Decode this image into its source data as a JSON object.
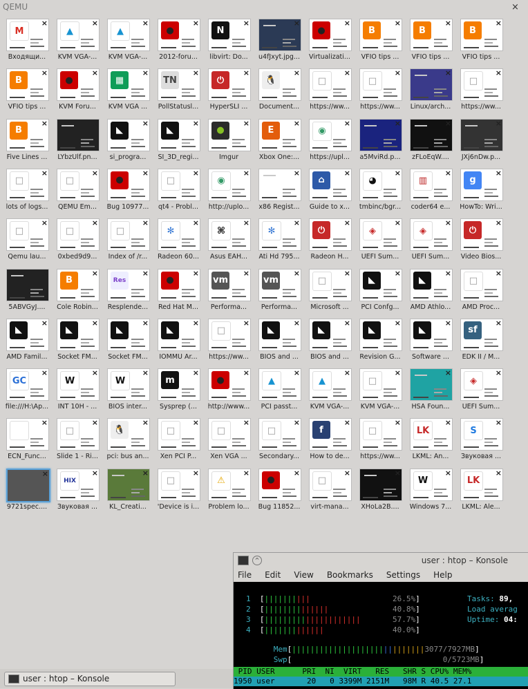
{
  "window": {
    "title": "QEMU",
    "close_glyph": "×"
  },
  "tabs": [
    {
      "label": "Входящи...",
      "icon": "gmail-icon",
      "color": "#ffffff",
      "glyph": "M",
      "gcolor": "#d93025"
    },
    {
      "label": "KVM VGA-...",
      "icon": "arch-linux-icon",
      "color": "#ffffff",
      "glyph": "▲",
      "gcolor": "#1793d1"
    },
    {
      "label": "KVM VGA-...",
      "icon": "arch-linux-icon",
      "color": "#ffffff",
      "glyph": "▲",
      "gcolor": "#1793d1"
    },
    {
      "label": "2012-foru...",
      "icon": "redhat-icon",
      "color": "#cc0000",
      "glyph": "●",
      "gcolor": "#222"
    },
    {
      "label": "libvirt: Do...",
      "icon": "libvirt-icon",
      "color": "#111111",
      "glyph": "N",
      "gcolor": "#fff"
    },
    {
      "label": "u4fJxyt.jpg...",
      "icon": "image-icon",
      "color": "#2b3a55",
      "glyph": "",
      "gcolor": "#fff"
    },
    {
      "label": "Virtualizati...",
      "icon": "redhat-icon",
      "color": "#cc0000",
      "glyph": "●",
      "gcolor": "#222"
    },
    {
      "label": "VFIO tips ...",
      "icon": "blogger-icon",
      "color": "#f57d00",
      "glyph": "B",
      "gcolor": "#fff"
    },
    {
      "label": "VFIO tips ...",
      "icon": "blogger-icon",
      "color": "#f57d00",
      "glyph": "B",
      "gcolor": "#fff"
    },
    {
      "label": "VFIO tips ...",
      "icon": "blogger-icon",
      "color": "#f57d00",
      "glyph": "B",
      "gcolor": "#fff"
    },
    {
      "label": "VFIO tips ...",
      "icon": "blogger-icon",
      "color": "#f57d00",
      "glyph": "B",
      "gcolor": "#fff"
    },
    {
      "label": "KVM Foru...",
      "icon": "redhat-icon",
      "color": "#cc0000",
      "glyph": "●",
      "gcolor": "#222"
    },
    {
      "label": "KVM VGA ...",
      "icon": "sheets-icon",
      "color": "#0f9d58",
      "glyph": "▦",
      "gcolor": "#fff"
    },
    {
      "label": "PollStatusl...",
      "icon": "tn-icon",
      "color": "#dddddd",
      "glyph": "TN",
      "gcolor": "#444"
    },
    {
      "label": "HyperSLI ...",
      "icon": "power-icon",
      "color": "#c62828",
      "glyph": "⏻",
      "gcolor": "#fff"
    },
    {
      "label": "Document...",
      "icon": "linux-icon",
      "color": "#eeeeee",
      "glyph": "🐧",
      "gcolor": "#222"
    },
    {
      "label": "https://ww...",
      "icon": "blank-page-icon",
      "color": "#ffffff",
      "glyph": "□",
      "gcolor": "#999"
    },
    {
      "label": "https://ww...",
      "icon": "blank-page-icon",
      "color": "#ffffff",
      "glyph": "□",
      "gcolor": "#999"
    },
    {
      "label": "Linux/arch...",
      "icon": "image-icon",
      "color": "#3a3a8a",
      "glyph": "",
      "gcolor": "#fff"
    },
    {
      "label": "https://ww...",
      "icon": "blank-page-icon",
      "color": "#ffffff",
      "glyph": "□",
      "gcolor": "#999"
    },
    {
      "label": "Five Lines ...",
      "icon": "blogger-icon",
      "color": "#f57d00",
      "glyph": "B",
      "gcolor": "#fff"
    },
    {
      "label": "LYbzUlf.pn...",
      "icon": "image-icon",
      "color": "#222222",
      "glyph": "",
      "gcolor": "#fff"
    },
    {
      "label": "si_progra...",
      "icon": "amd-icon",
      "color": "#111111",
      "glyph": "◣",
      "gcolor": "#fff"
    },
    {
      "label": "SI_3D_regi...",
      "icon": "amd-icon",
      "color": "#111111",
      "glyph": "◣",
      "gcolor": "#fff"
    },
    {
      "label": "Imgur",
      "icon": "imgur-icon",
      "color": "#2b2b2b",
      "glyph": "●",
      "gcolor": "#85bf25"
    },
    {
      "label": "Xbox One:...",
      "icon": "e-icon",
      "color": "#e35d0c",
      "glyph": "E",
      "gcolor": "#fff"
    },
    {
      "label": "https://upl...",
      "icon": "wikimedia-icon",
      "color": "#ffffff",
      "glyph": "◉",
      "gcolor": "#339966"
    },
    {
      "label": "a5MviRd.p...",
      "icon": "image-icon",
      "color": "#1a237e",
      "glyph": "",
      "gcolor": "#fff"
    },
    {
      "label": "zFLoEqW....",
      "icon": "image-icon",
      "color": "#111111",
      "glyph": "",
      "gcolor": "#fff"
    },
    {
      "label": "JXj6nDw.p...",
      "icon": "image-icon",
      "color": "#333333",
      "glyph": "",
      "gcolor": "#fff"
    },
    {
      "label": "lots of logs...",
      "icon": "blank-page-icon",
      "color": "#ffffff",
      "glyph": "□",
      "gcolor": "#999"
    },
    {
      "label": "QEMU Em...",
      "icon": "blank-page-icon",
      "color": "#ffffff",
      "glyph": "□",
      "gcolor": "#999"
    },
    {
      "label": "Bug 10977...",
      "icon": "redhat-icon",
      "color": "#cc0000",
      "glyph": "●",
      "gcolor": "#222"
    },
    {
      "label": "qt4 - Probl...",
      "icon": "blank-page-icon",
      "color": "#ffffff",
      "glyph": "□",
      "gcolor": "#999"
    },
    {
      "label": "http://uplo...",
      "icon": "wikimedia-icon",
      "color": "#ffffff",
      "glyph": "◉",
      "gcolor": "#339966"
    },
    {
      "label": "x86 Regist...",
      "icon": "image-icon",
      "color": "#ffffff",
      "glyph": "",
      "gcolor": "#fff"
    },
    {
      "label": "Guide to x...",
      "icon": "museum-icon",
      "color": "#2e5aa8",
      "glyph": "⌂",
      "gcolor": "#fff"
    },
    {
      "label": "tmbinc/bgr...",
      "icon": "github-icon",
      "color": "#ffffff",
      "glyph": "◕",
      "gcolor": "#111"
    },
    {
      "label": "coder64 e...",
      "icon": "grid-icon",
      "color": "#ffffff",
      "glyph": "▥",
      "gcolor": "#b22"
    },
    {
      "label": "HowTo: Wri...",
      "icon": "google-icon",
      "color": "#4285f4",
      "glyph": "g",
      "gcolor": "#fff"
    },
    {
      "label": "Qemu lau...",
      "icon": "blank-page-icon",
      "color": "#ffffff",
      "glyph": "□",
      "gcolor": "#999"
    },
    {
      "label": "0xbed9d9...",
      "icon": "blank-page-icon",
      "color": "#ffffff",
      "glyph": "□",
      "gcolor": "#999"
    },
    {
      "label": "Index of /r...",
      "icon": "blank-page-icon",
      "color": "#ffffff",
      "glyph": "□",
      "gcolor": "#999"
    },
    {
      "label": "Radeon 60...",
      "icon": "flower-icon",
      "color": "#ffffff",
      "glyph": "✻",
      "gcolor": "#3a7bd5"
    },
    {
      "label": "Asus EAH...",
      "icon": "command-icon",
      "color": "#ffffff",
      "glyph": "⌘",
      "gcolor": "#111"
    },
    {
      "label": "Ati Hd 795...",
      "icon": "flower-icon",
      "color": "#ffffff",
      "glyph": "✻",
      "gcolor": "#3a7bd5"
    },
    {
      "label": "Radeon H...",
      "icon": "power-icon",
      "color": "#c62828",
      "glyph": "⏻",
      "gcolor": "#fff"
    },
    {
      "label": "UEFI Sum...",
      "icon": "cube-icon",
      "color": "#ffffff",
      "glyph": "◈",
      "gcolor": "#c62828"
    },
    {
      "label": "UEFI Sum...",
      "icon": "cube-icon",
      "color": "#ffffff",
      "glyph": "◈",
      "gcolor": "#c62828"
    },
    {
      "label": "Video Bios...",
      "icon": "power-icon",
      "color": "#c62828",
      "glyph": "⏻",
      "gcolor": "#fff"
    },
    {
      "label": "5ABVGyJ....",
      "icon": "image-icon",
      "color": "#222222",
      "glyph": "",
      "gcolor": "#fff"
    },
    {
      "label": "Cole Robin...",
      "icon": "blogger-icon",
      "color": "#f57d00",
      "glyph": "B",
      "gcolor": "#fff"
    },
    {
      "label": "Resplende...",
      "icon": "res-icon",
      "color": "#eeeeff",
      "glyph": "Res",
      "gcolor": "#7a3fc9"
    },
    {
      "label": "Red Hat M...",
      "icon": "redhat-icon",
      "color": "#cc0000",
      "glyph": "●",
      "gcolor": "#222"
    },
    {
      "label": "Performa...",
      "icon": "vmware-icon",
      "color": "#555555",
      "glyph": "vm",
      "gcolor": "#fff"
    },
    {
      "label": "Performa...",
      "icon": "vmware-icon",
      "color": "#555555",
      "glyph": "vm",
      "gcolor": "#fff"
    },
    {
      "label": "Microsoft ...",
      "icon": "blank-page-icon",
      "color": "#ffffff",
      "glyph": "□",
      "gcolor": "#999"
    },
    {
      "label": "PCI Confg...",
      "icon": "amd-icon",
      "color": "#111111",
      "glyph": "◣",
      "gcolor": "#fff"
    },
    {
      "label": "AMD Athlo...",
      "icon": "amd-icon",
      "color": "#111111",
      "glyph": "◣",
      "gcolor": "#fff"
    },
    {
      "label": "AMD Proc...",
      "icon": "blank-page-icon",
      "color": "#ffffff",
      "glyph": "□",
      "gcolor": "#999"
    },
    {
      "label": "AMD Famil...",
      "icon": "amd-icon",
      "color": "#111111",
      "glyph": "◣",
      "gcolor": "#fff"
    },
    {
      "label": "Socket FM...",
      "icon": "amd-icon",
      "color": "#111111",
      "glyph": "◣",
      "gcolor": "#fff"
    },
    {
      "label": "Socket FM...",
      "icon": "amd-icon",
      "color": "#111111",
      "glyph": "◣",
      "gcolor": "#fff"
    },
    {
      "label": "IOMMU Ar...",
      "icon": "amd-icon",
      "color": "#111111",
      "glyph": "◣",
      "gcolor": "#fff"
    },
    {
      "label": "https://ww...",
      "icon": "blank-page-icon",
      "color": "#ffffff",
      "glyph": "□",
      "gcolor": "#999"
    },
    {
      "label": "BIOS and ...",
      "icon": "amd-icon",
      "color": "#111111",
      "glyph": "◣",
      "gcolor": "#fff"
    },
    {
      "label": "BIOS and ...",
      "icon": "amd-icon",
      "color": "#111111",
      "glyph": "◣",
      "gcolor": "#fff"
    },
    {
      "label": "Revision G...",
      "icon": "amd-icon",
      "color": "#111111",
      "glyph": "◣",
      "gcolor": "#fff"
    },
    {
      "label": "Software ...",
      "icon": "amd-icon",
      "color": "#111111",
      "glyph": "◣",
      "gcolor": "#fff"
    },
    {
      "label": "EDK II / M...",
      "icon": "sf-icon",
      "color": "#35617f",
      "glyph": "sf",
      "gcolor": "#fff"
    },
    {
      "label": "file:///H:\\Ap...",
      "icon": "gc-icon",
      "color": "#ffffff",
      "glyph": "GC",
      "gcolor": "#2a6fd6"
    },
    {
      "label": "INT 10H - ...",
      "icon": "wikipedia-icon",
      "color": "#ffffff",
      "glyph": "W",
      "gcolor": "#111"
    },
    {
      "label": "BIOS inter...",
      "icon": "wikipedia-icon",
      "color": "#ffffff",
      "glyph": "W",
      "gcolor": "#111"
    },
    {
      "label": "Sysprep (...",
      "icon": "m-icon",
      "color": "#111111",
      "glyph": "m",
      "gcolor": "#fff"
    },
    {
      "label": "http://www...",
      "icon": "redhat-icon",
      "color": "#cc0000",
      "glyph": "●",
      "gcolor": "#222"
    },
    {
      "label": "PCI passt...",
      "icon": "arch-linux-icon",
      "color": "#ffffff",
      "glyph": "▲",
      "gcolor": "#1793d1"
    },
    {
      "label": "KVM VGA-...",
      "icon": "arch-linux-icon",
      "color": "#ffffff",
      "glyph": "▲",
      "gcolor": "#1793d1"
    },
    {
      "label": "KVM VGA-...",
      "icon": "blank-page-icon",
      "color": "#ffffff",
      "glyph": "□",
      "gcolor": "#999"
    },
    {
      "label": "HSA Foun...",
      "icon": "image-icon",
      "color": "#1fa3a3",
      "glyph": "",
      "gcolor": "#fff"
    },
    {
      "label": "UEFI Sum...",
      "icon": "cube-icon",
      "color": "#ffffff",
      "glyph": "◈",
      "gcolor": "#c62828"
    },
    {
      "label": "ECN_Func...",
      "icon": "blank-page-icon",
      "color": "#ffffff",
      "glyph": "",
      "gcolor": "#999"
    },
    {
      "label": "Slide 1 - Ri...",
      "icon": "blank-page-icon",
      "color": "#ffffff",
      "glyph": "□",
      "gcolor": "#999"
    },
    {
      "label": "pci: bus an...",
      "icon": "linux-icon",
      "color": "#eeeeee",
      "glyph": "🐧",
      "gcolor": "#222"
    },
    {
      "label": "Xen PCI P...",
      "icon": "blank-page-icon",
      "color": "#ffffff",
      "glyph": "□",
      "gcolor": "#999"
    },
    {
      "label": "Xen VGA ...",
      "icon": "blank-page-icon",
      "color": "#ffffff",
      "glyph": "□",
      "gcolor": "#999"
    },
    {
      "label": "Secondary...",
      "icon": "blank-page-icon",
      "color": "#ffffff",
      "glyph": "□",
      "gcolor": "#999"
    },
    {
      "label": "How to de...",
      "icon": "fedora-icon",
      "color": "#294172",
      "glyph": "f",
      "gcolor": "#fff"
    },
    {
      "label": "https://ww...",
      "icon": "blank-page-icon",
      "color": "#ffffff",
      "glyph": "□",
      "gcolor": "#999"
    },
    {
      "label": "LKML: An...",
      "icon": "lkml-icon",
      "color": "#ffffff",
      "glyph": "LK",
      "gcolor": "#c62828"
    },
    {
      "label": "Звуковая ...",
      "icon": "s-icon",
      "color": "#ffffff",
      "glyph": "S",
      "gcolor": "#1f7ae0"
    },
    {
      "label": "9721spec....",
      "icon": "image-icon",
      "color": "#555555",
      "glyph": "",
      "gcolor": "#fff",
      "selected": true
    },
    {
      "label": "Звуковая ...",
      "icon": "hix-icon",
      "color": "#ffffff",
      "glyph": "HIX",
      "gcolor": "#223399"
    },
    {
      "label": "KL_Creati...",
      "icon": "image-icon",
      "color": "#5a7a3a",
      "glyph": "",
      "gcolor": "#fff"
    },
    {
      "label": "'Device is i...",
      "icon": "blank-page-icon",
      "color": "#ffffff",
      "glyph": "□",
      "gcolor": "#999"
    },
    {
      "label": "Problem lo...",
      "icon": "warning-icon",
      "color": "#ffffff",
      "glyph": "⚠",
      "gcolor": "#e6a700"
    },
    {
      "label": "Bug 11852...",
      "icon": "redhat-icon",
      "color": "#cc0000",
      "glyph": "●",
      "gcolor": "#222"
    },
    {
      "label": "virt-mana...",
      "icon": "blank-page-icon",
      "color": "#ffffff",
      "glyph": "□",
      "gcolor": "#999"
    },
    {
      "label": "XHoLa2B....",
      "icon": "image-icon",
      "color": "#111111",
      "glyph": "",
      "gcolor": "#fff"
    },
    {
      "label": "Windows 7...",
      "icon": "wikipedia-icon",
      "color": "#ffffff",
      "glyph": "W",
      "gcolor": "#111"
    },
    {
      "label": "LKML: Ale...",
      "icon": "lkml-icon",
      "color": "#ffffff",
      "glyph": "LK",
      "gcolor": "#c62828"
    }
  ],
  "konsole": {
    "title": "user : htop – Konsole",
    "menu": [
      "File",
      "Edit",
      "View",
      "Bookmarks",
      "Settings",
      "Help"
    ],
    "cpus": [
      {
        "n": "1",
        "green": "|||||||",
        "red": "|||",
        "pct": "26.5%"
      },
      {
        "n": "2",
        "green": "||||||||",
        "red": "||||||",
        "pct": "40.8%"
      },
      {
        "n": "3",
        "green": "|||||||||",
        "red": "||||||||||||",
        "pct": "57.7%"
      },
      {
        "n": "4",
        "green": "|||||||",
        "red": "||||||",
        "pct": "40.0%"
      }
    ],
    "mem": {
      "label": "Mem",
      "value": "3077/7927MB"
    },
    "swp": {
      "label": "Swp",
      "value": "0/5723MB"
    },
    "info": [
      {
        "label": "Tasks: ",
        "value": "89,"
      },
      {
        "label": "Load averag",
        "value": ""
      },
      {
        "label": "Uptime: ",
        "value": "04:"
      }
    ],
    "header": " PID USER      PRI  NI  VIRT   RES   SHR S CPU% MEM%",
    "row": "1950 user       20   0 3399M 2151M   98M R 40.5 27.1"
  },
  "taskbar": {
    "label": "user : htop – Konsole"
  }
}
